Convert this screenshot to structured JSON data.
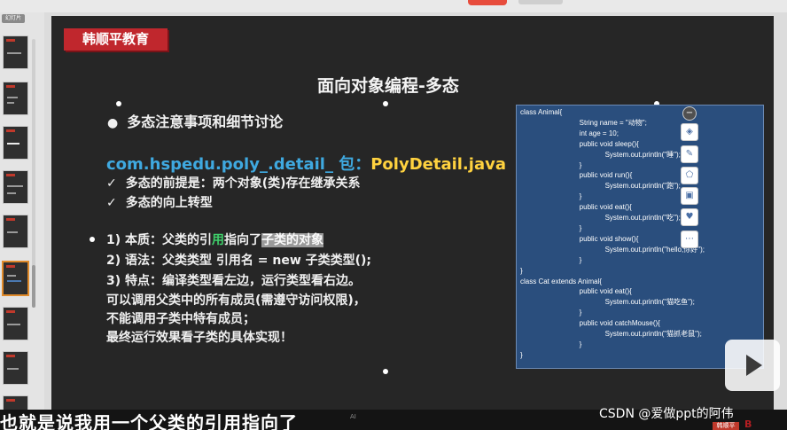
{
  "rail": {
    "top_label": "幻灯片"
  },
  "slide": {
    "brand": "韩顺平教育",
    "title": "面向对象编程-多态",
    "subtitle": "多态注意事项和细节讨论",
    "package_prefix": "com.hspedu.poly_.detail_ 包：",
    "package_file": "PolyDetail.java",
    "checks": [
      "多态的前提是：两个对象(类)存在继承关系",
      "多态的向上转型"
    ],
    "points": [
      {
        "a": "1) 本质：父类的引",
        "cur": "用",
        "b": "指向了",
        "hl": "子类的对象"
      },
      {
        "text": "2) 语法：父类类型      引用名 = new  子类类型();"
      },
      {
        "text": "3) 特点：编译类型看左边，运行类型看右边。"
      },
      {
        "text": "    可以调用父类中的所有成员(需遵守访问权限)，"
      },
      {
        "text": "    不能调用子类中特有成员；"
      },
      {
        "text": "    最终运行效果看子类的具体实现！"
      }
    ],
    "code": "class Animal{\n                              String name = \"动物\";\n                              int age = 10;\n                              public void sleep(){\n                                           System.out.println(\"睡\");\n                              }\n                              public void run(){\n                                           System.out.println(\"跑\");\n                              }\n                              public void eat(){\n                                           System.out.println(\"吃\");\n                              }\n                              public void show(){\n                                           System.out.println(\"hello,你好\");\n                              }\n}\nclass Cat extends Animal{\n                              public void eat(){\n                                           System.out.println(\"猫吃鱼\");\n                              }\n                              public void catchMouse(){\n                                           System.out.println(\"猫抓老鼠\");\n                              }\n}",
    "tool_icons": [
      "minus-icon",
      "layers-icon",
      "pen-icon",
      "shape-icon",
      "crop-icon",
      "bulb-icon",
      "more-icon"
    ]
  },
  "overlay": {
    "subtitle": "也就是说我用一个父类的引用指向了",
    "ai_mark": "AI",
    "watermark": "CSDN @爱做ppt的阿伟",
    "user_tag": "韩顺平",
    "bl_text": "B"
  },
  "colors": {
    "brand_red": "#c0272d",
    "package_blue": "#3fa9e0",
    "package_yellow": "#ffd23f",
    "code_bg": "#2a4e7d",
    "slide_bg": "#262626"
  }
}
